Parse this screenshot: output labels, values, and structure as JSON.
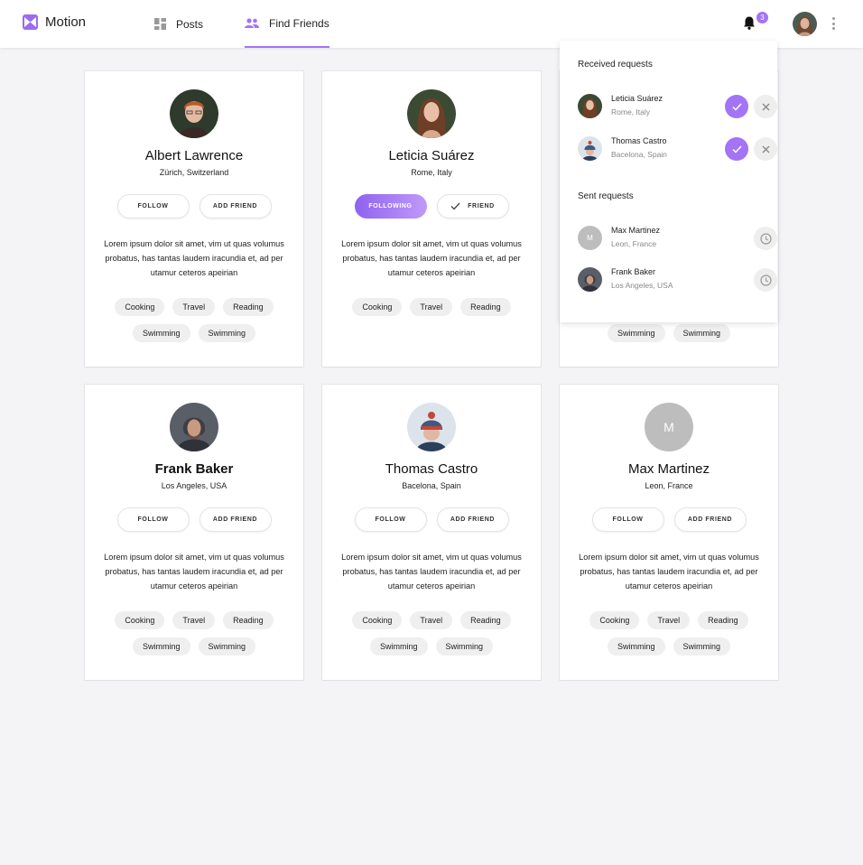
{
  "app": {
    "name": "Motion",
    "accent": "#a374f5"
  },
  "nav": {
    "posts": "Posts",
    "find_friends": "Find Friends",
    "active": "find_friends"
  },
  "header": {
    "notification_count": "3"
  },
  "requests": {
    "received_title": "Received requests",
    "sent_title": "Sent requests",
    "received": [
      {
        "name": "Leticia Suárez",
        "location": "Rome, Italy"
      },
      {
        "name": "Thomas Castro",
        "location": "Bacelona, Spain"
      }
    ],
    "sent": [
      {
        "name": "Max Martinez",
        "location": "Leon, France",
        "initial": "M"
      },
      {
        "name": "Frank Baker",
        "location": "Los Angeles, USA"
      }
    ]
  },
  "buttons": {
    "follow": "FOLLOW",
    "add_friend": "ADD FRIEND",
    "following": "FOLLOWING",
    "friend": "FRIEND"
  },
  "description": "Lorem ipsum dolor sit amet, vim ut quas volumus probatus, has tantas laudem iracundia et, ad per utamur ceteros apeirian",
  "cards": [
    {
      "name": "Albert Lawrence",
      "location": "Zürich, Switzerland",
      "tags": [
        "Cooking",
        "Travel",
        "Reading",
        "Swimming",
        "Swimming"
      ]
    },
    {
      "name": "Leticia Suárez",
      "location": "Rome, Italy",
      "tags": [
        "Cooking",
        "Travel",
        "Reading"
      ]
    },
    {
      "tags": [
        "Swimming",
        "Swimming"
      ]
    },
    {
      "name": "Frank Baker",
      "location": "Los Angeles, USA",
      "tags": [
        "Cooking",
        "Travel",
        "Reading",
        "Swimming",
        "Swimming"
      ]
    },
    {
      "name": "Thomas Castro",
      "location": "Bacelona, Spain",
      "tags": [
        "Cooking",
        "Travel",
        "Reading",
        "Swimming",
        "Swimming"
      ]
    },
    {
      "name": "Max Martinez",
      "location": "Leon, France",
      "initial": "M",
      "tags": [
        "Cooking",
        "Travel",
        "Reading",
        "Swimming",
        "Swimming"
      ]
    }
  ]
}
